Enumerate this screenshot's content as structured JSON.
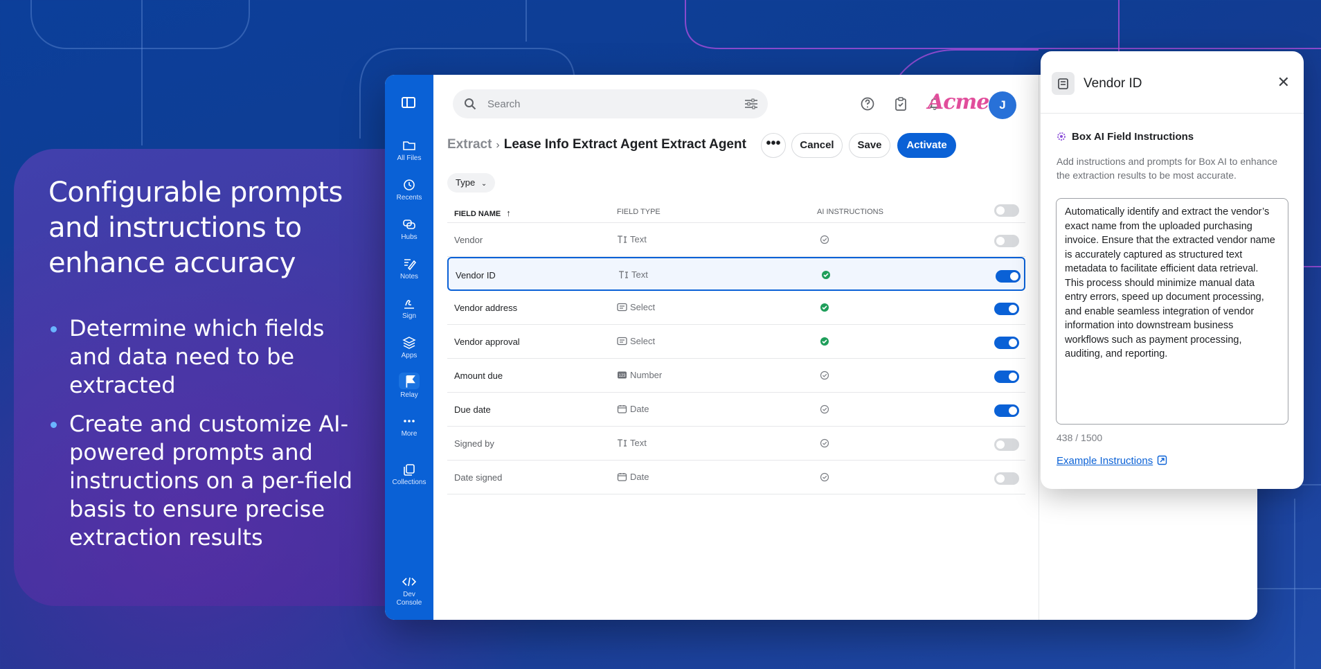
{
  "promo": {
    "heading": "Configurable prompts and instructions to enhance accuracy",
    "bullets": [
      "Determine which fields and data need to be extracted",
      "Create and customize AI-powered prompts and instructions on a per-field basis to ensure precise extraction results"
    ]
  },
  "nav": {
    "items": [
      {
        "label": "All Files",
        "icon": "folder-icon"
      },
      {
        "label": "Recents",
        "icon": "clock-icon"
      },
      {
        "label": "Hubs",
        "icon": "hubs-icon"
      },
      {
        "label": "Notes",
        "icon": "notes-icon"
      },
      {
        "label": "Sign",
        "icon": "sign-icon"
      },
      {
        "label": "Apps",
        "icon": "apps-icon"
      },
      {
        "label": "Relay",
        "icon": "relay-flag-icon"
      },
      {
        "label": "More",
        "icon": "more-dots-icon"
      },
      {
        "label": "Collections",
        "icon": "collections-icon"
      }
    ],
    "dev_console": "Dev Console"
  },
  "search": {
    "placeholder": "Search"
  },
  "brand": {
    "logo_text": "Acme",
    "avatar_initial": "J"
  },
  "breadcrumb": {
    "parent": "Extract",
    "current": "Lease Info Extract Agent Extract Agent"
  },
  "actions": {
    "more": "•••",
    "cancel": "Cancel",
    "save": "Save",
    "activate": "Activate"
  },
  "filter": {
    "type_label": "Type"
  },
  "table": {
    "headers": {
      "field_name": "FIELD NAME",
      "field_type": "FIELD TYPE",
      "ai_instructions": "AI INSTRUCTIONS"
    },
    "rows": [
      {
        "name": "Vendor",
        "type": "Text",
        "type_icon": "text-icon",
        "ai_set": false,
        "enabled": false,
        "selected": false
      },
      {
        "name": "Vendor ID",
        "type": "Text",
        "type_icon": "text-icon",
        "ai_set": true,
        "enabled": true,
        "selected": true
      },
      {
        "name": "Vendor address",
        "type": "Select",
        "type_icon": "select-icon",
        "ai_set": true,
        "enabled": true,
        "selected": false
      },
      {
        "name": "Vendor approval",
        "type": "Select",
        "type_icon": "select-icon",
        "ai_set": true,
        "enabled": true,
        "selected": false
      },
      {
        "name": "Amount due",
        "type": "Number",
        "type_icon": "number-icon",
        "ai_set": false,
        "enabled": true,
        "selected": false
      },
      {
        "name": "Due date",
        "type": "Date",
        "type_icon": "calendar-icon",
        "ai_set": false,
        "enabled": true,
        "selected": false
      },
      {
        "name": "Signed by",
        "type": "Text",
        "type_icon": "text-icon",
        "ai_set": false,
        "enabled": false,
        "selected": false
      },
      {
        "name": "Date signed",
        "type": "Date",
        "type_icon": "calendar-icon",
        "ai_set": false,
        "enabled": false,
        "selected": false
      }
    ]
  },
  "panel": {
    "title": "Vendor ID",
    "section_title": "Box AI Field Instructions",
    "description": "Add instructions and prompts for Box AI to enhance the extraction results to be most accurate.",
    "instructions": "Automatically identify and extract the vendor’s exact name from the uploaded purchasing invoice. Ensure that the extracted vendor name is accurately captured as structured text metadata to facilitate efficient data retrieval. This process should minimize manual data entry errors, speed up document processing, and enable seamless integration of vendor information into downstream business workflows such as payment processing, auditing, and reporting.",
    "char_count": "438 / 1500",
    "link_label": "Example Instructions"
  },
  "colors": {
    "accent": "#0a61d6",
    "brand_pink": "#e14d9b",
    "success": "#1e9e5a"
  }
}
